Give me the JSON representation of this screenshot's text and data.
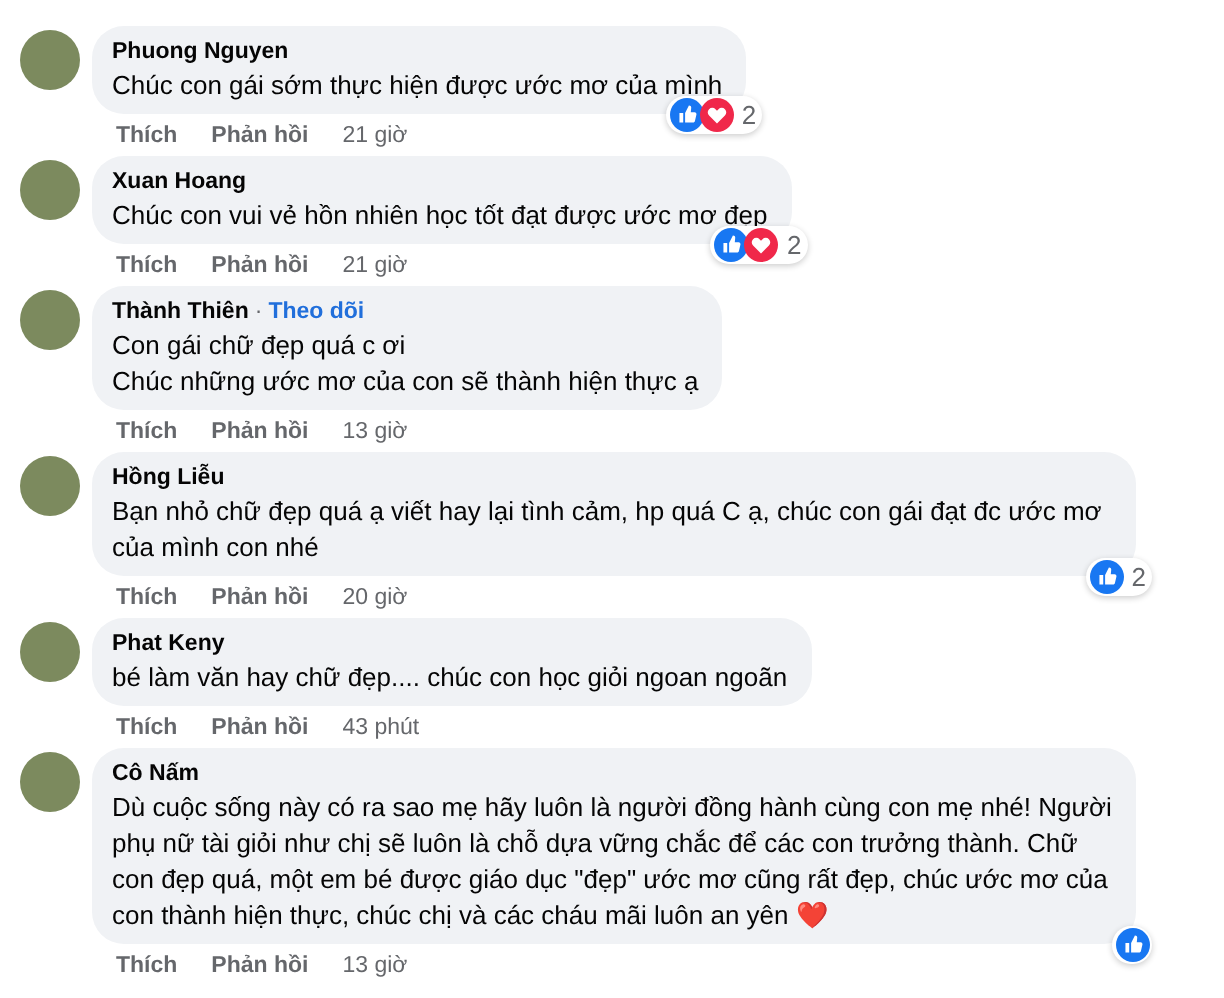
{
  "comments": [
    {
      "name": "Phuong Nguyen",
      "paragraphs": [
        "Chúc con gái sớm thực hiện được ước mơ của mình"
      ],
      "like": "Thích",
      "reply": "Phản hồi",
      "time": "21 giờ",
      "reactions": [
        {
          "kind": "like"
        },
        {
          "kind": "love"
        }
      ],
      "reaction_count": "2"
    },
    {
      "name": "Xuan Hoang",
      "paragraphs": [
        "Chúc con vui vẻ hồn nhiên học tốt đạt được ước mơ đẹp"
      ],
      "like": "Thích",
      "reply": "Phản hồi",
      "time": "21 giờ",
      "reactions": [
        {
          "kind": "like"
        },
        {
          "kind": "love"
        }
      ],
      "reaction_count": "2"
    },
    {
      "name": "Thành Thiên",
      "separator": "·",
      "follow": "Theo dõi",
      "paragraphs": [
        "Con gái chữ đẹp quá c ơi",
        "Chúc những ước mơ của con sẽ thành hiện thực ạ"
      ],
      "like": "Thích",
      "reply": "Phản hồi",
      "time": "13 giờ"
    },
    {
      "name": "Hồng Liễu",
      "paragraphs": [
        "Bạn nhỏ chữ đẹp quá ạ viết hay lại tình cảm, hp quá C ạ, chúc con gái đạt đc ước mơ của mình con nhé"
      ],
      "like": "Thích",
      "reply": "Phản hồi",
      "time": "20 giờ",
      "reactions": [
        {
          "kind": "like"
        }
      ],
      "reaction_count": "2"
    },
    {
      "name": "Phat Keny",
      "paragraphs": [
        "bé làm văn hay chữ đẹp.... chúc con học giỏi ngoan ngoãn"
      ],
      "like": "Thích",
      "reply": "Phản hồi",
      "time": "43 phút"
    },
    {
      "name": "Cô Nấm",
      "paragraphs": [
        "Dù cuộc sống này có ra sao mẹ hãy luôn là người đồng hành cùng con mẹ nhé! Người phụ nữ tài giỏi như chị sẽ luôn là chỗ dựa vững chắc để các con trưởng thành. Chữ con đẹp quá, một em bé được giáo dục \"đẹp\" ước mơ cũng rất đẹp, chúc ước mơ của con thành hiện thực, chúc chị và các cháu mãi luôn an yên ❤️"
      ],
      "like": "Thích",
      "reply": "Phản hồi",
      "time": "13 giờ",
      "reactions": [
        {
          "kind": "like"
        }
      ]
    }
  ]
}
